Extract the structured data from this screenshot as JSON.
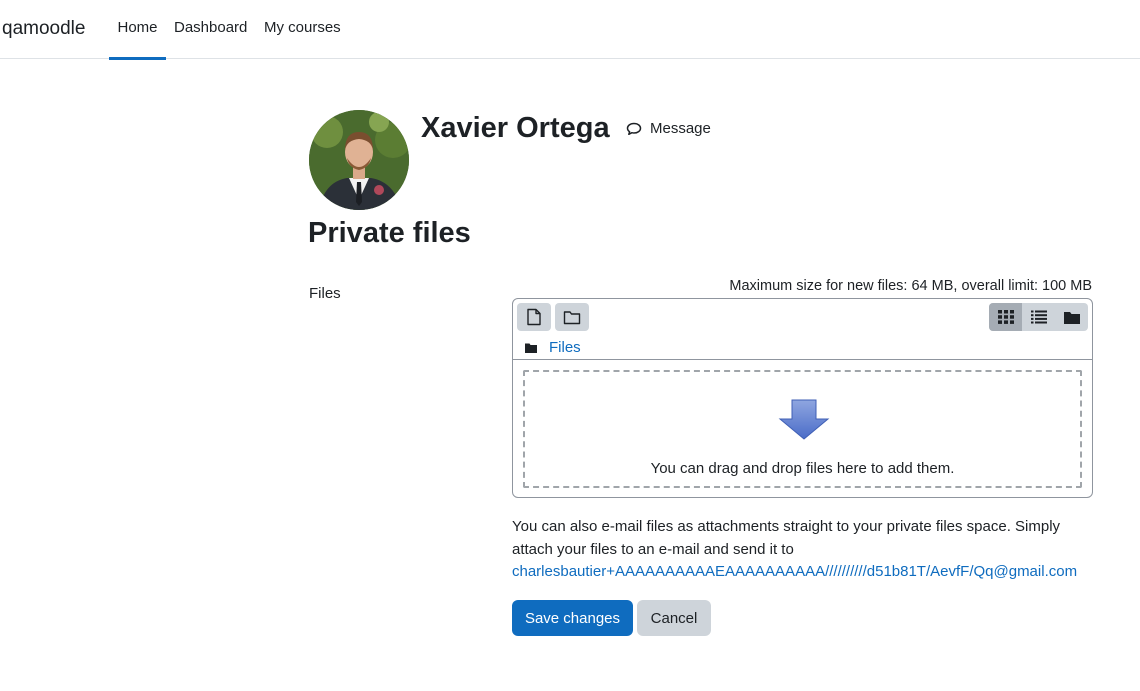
{
  "navbar": {
    "brand": "qamoodle",
    "items": [
      {
        "label": "Home",
        "active": true
      },
      {
        "label": "Dashboard"
      },
      {
        "label": "My courses"
      }
    ]
  },
  "profile": {
    "name": "Xavier Ortega",
    "message_label": "Message",
    "icons": {
      "avatar": "user-photo",
      "message": "chat-bubble-icon"
    }
  },
  "page": {
    "title": "Private files"
  },
  "files_form": {
    "label": "Files",
    "max_size_text": "Maximum size for new files: 64 MB, overall limit: 100 MB",
    "path_label": "Files",
    "drop_text": "You can drag and drop files here to add them.",
    "toolbar_icons": [
      "add-file-icon",
      "create-folder-icon"
    ],
    "view_icons": [
      "grid-view-icon",
      "list-view-icon",
      "tree-view-icon"
    ]
  },
  "email_info": {
    "text": "You can also e-mail files as attachments straight to your private files space. Simply attach your files to an e-mail and send it to",
    "address": "charlesbautier+AAAAAAAAAAEAAAAAAAAAA//////////d51b81T/AevfF/Qq@gmail.com"
  },
  "actions": {
    "save_label": "Save changes",
    "cancel_label": "Cancel"
  },
  "colors": {
    "primary": "#0f6cbf",
    "secondary": "#ced4da",
    "text": "#1d2125"
  }
}
